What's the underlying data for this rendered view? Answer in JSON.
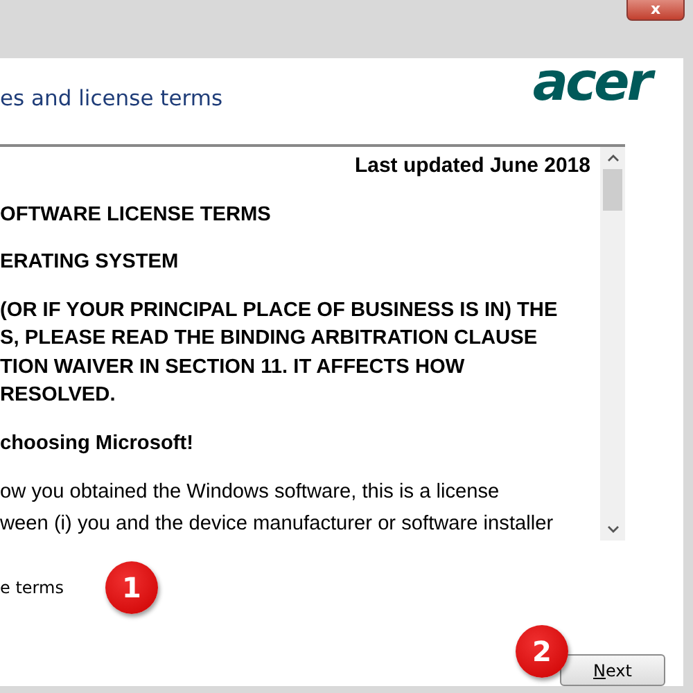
{
  "window": {
    "close": "x"
  },
  "logo": "acer",
  "heading": "es and license terms",
  "license_text": [
    {
      "kind": "date",
      "text": "Last updated June 2018"
    },
    {
      "kind": "bold",
      "text": "OFTWARE LICENSE TERMS"
    },
    {
      "kind": "bold",
      "text": "ERATING SYSTEM"
    },
    {
      "kind": "bold",
      "text": "(OR IF YOUR PRINCIPAL PLACE OF BUSINESS IS IN) THE"
    },
    {
      "kind": "bold",
      "text": "S, PLEASE READ THE BINDING ARBITRATION CLAUSE"
    },
    {
      "kind": "bold",
      "text": "TION WAIVER IN SECTION 11. IT AFFECTS HOW"
    },
    {
      "kind": "bold",
      "text": "RESOLVED."
    },
    {
      "kind": "bold",
      "text": "choosing Microsoft!"
    },
    {
      "kind": "normal",
      "text": "ow you obtained the Windows software, this is a license"
    },
    {
      "kind": "normal",
      "text": "ween (i) you and the device manufacturer or software installer"
    }
  ],
  "accept_label": "e terms",
  "step_badges": [
    "1",
    "2"
  ],
  "buttons": [
    {
      "label": "Next"
    }
  ]
}
